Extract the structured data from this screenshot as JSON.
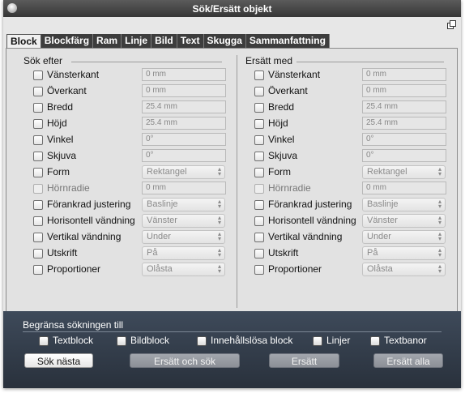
{
  "window": {
    "title": "Sök/Ersätt objekt"
  },
  "tabs": [
    "Block",
    "Blockfärg",
    "Ram",
    "Linje",
    "Bild",
    "Text",
    "Skugga",
    "Sammanfattning"
  ],
  "search": {
    "title": "Sök efter",
    "rows": [
      {
        "label": "Vänsterkant",
        "kind": "field",
        "value": "0 mm",
        "enabled": true
      },
      {
        "label": "Överkant",
        "kind": "field",
        "value": "0 mm",
        "enabled": true
      },
      {
        "label": "Bredd",
        "kind": "field",
        "value": "25.4 mm",
        "enabled": true
      },
      {
        "label": "Höjd",
        "kind": "field",
        "value": "25.4 mm",
        "enabled": true
      },
      {
        "label": "Vinkel",
        "kind": "field",
        "value": "0°",
        "enabled": true
      },
      {
        "label": "Skjuva",
        "kind": "field",
        "value": "0°",
        "enabled": true
      },
      {
        "label": "Form",
        "kind": "select",
        "value": "Rektangel",
        "enabled": true
      },
      {
        "label": "Hörnradie",
        "kind": "field",
        "value": "0 mm",
        "enabled": false
      },
      {
        "label": "Förankrad justering",
        "kind": "select",
        "value": "Baslinje",
        "enabled": true
      },
      {
        "label": "Horisontell vändning",
        "kind": "select",
        "value": "Vänster",
        "enabled": true
      },
      {
        "label": "Vertikal vändning",
        "kind": "select",
        "value": "Under",
        "enabled": true
      },
      {
        "label": "Utskrift",
        "kind": "select",
        "value": "På",
        "enabled": true
      },
      {
        "label": "Proportioner",
        "kind": "select",
        "value": "Olåsta",
        "enabled": true
      }
    ]
  },
  "replace": {
    "title": "Ersätt med",
    "rows": [
      {
        "label": "Vänsterkant",
        "kind": "field",
        "value": "0 mm",
        "enabled": true
      },
      {
        "label": "Överkant",
        "kind": "field",
        "value": "0 mm",
        "enabled": true
      },
      {
        "label": "Bredd",
        "kind": "field",
        "value": "25.4 mm",
        "enabled": true
      },
      {
        "label": "Höjd",
        "kind": "field",
        "value": "25.4 mm",
        "enabled": true
      },
      {
        "label": "Vinkel",
        "kind": "field",
        "value": "0°",
        "enabled": true
      },
      {
        "label": "Skjuva",
        "kind": "field",
        "value": "0°",
        "enabled": true
      },
      {
        "label": "Form",
        "kind": "select",
        "value": "Rektangel",
        "enabled": true
      },
      {
        "label": "Hörnradie",
        "kind": "field",
        "value": "0 mm",
        "enabled": false
      },
      {
        "label": "Förankrad justering",
        "kind": "select",
        "value": "Baslinje",
        "enabled": true
      },
      {
        "label": "Horisontell vändning",
        "kind": "select",
        "value": "Vänster",
        "enabled": true
      },
      {
        "label": "Vertikal vändning",
        "kind": "select",
        "value": "Under",
        "enabled": true
      },
      {
        "label": "Utskrift",
        "kind": "select",
        "value": "På",
        "enabled": true
      },
      {
        "label": "Proportioner",
        "kind": "select",
        "value": "Olåsta",
        "enabled": true
      }
    ]
  },
  "limit": {
    "title": "Begränsa sökningen till",
    "options": [
      "Textblock",
      "Bildblock",
      "Innehållslösa block",
      "Linjer",
      "Textbanor"
    ]
  },
  "buttons": {
    "find_next": "Sök nästa",
    "replace_and_find": "Ersätt och sök",
    "replace": "Ersätt",
    "replace_all": "Ersätt alla"
  },
  "icons": {
    "close": "close-icon",
    "collapse": "collapse-icon",
    "select_arrows": "updown-arrows-icon"
  }
}
